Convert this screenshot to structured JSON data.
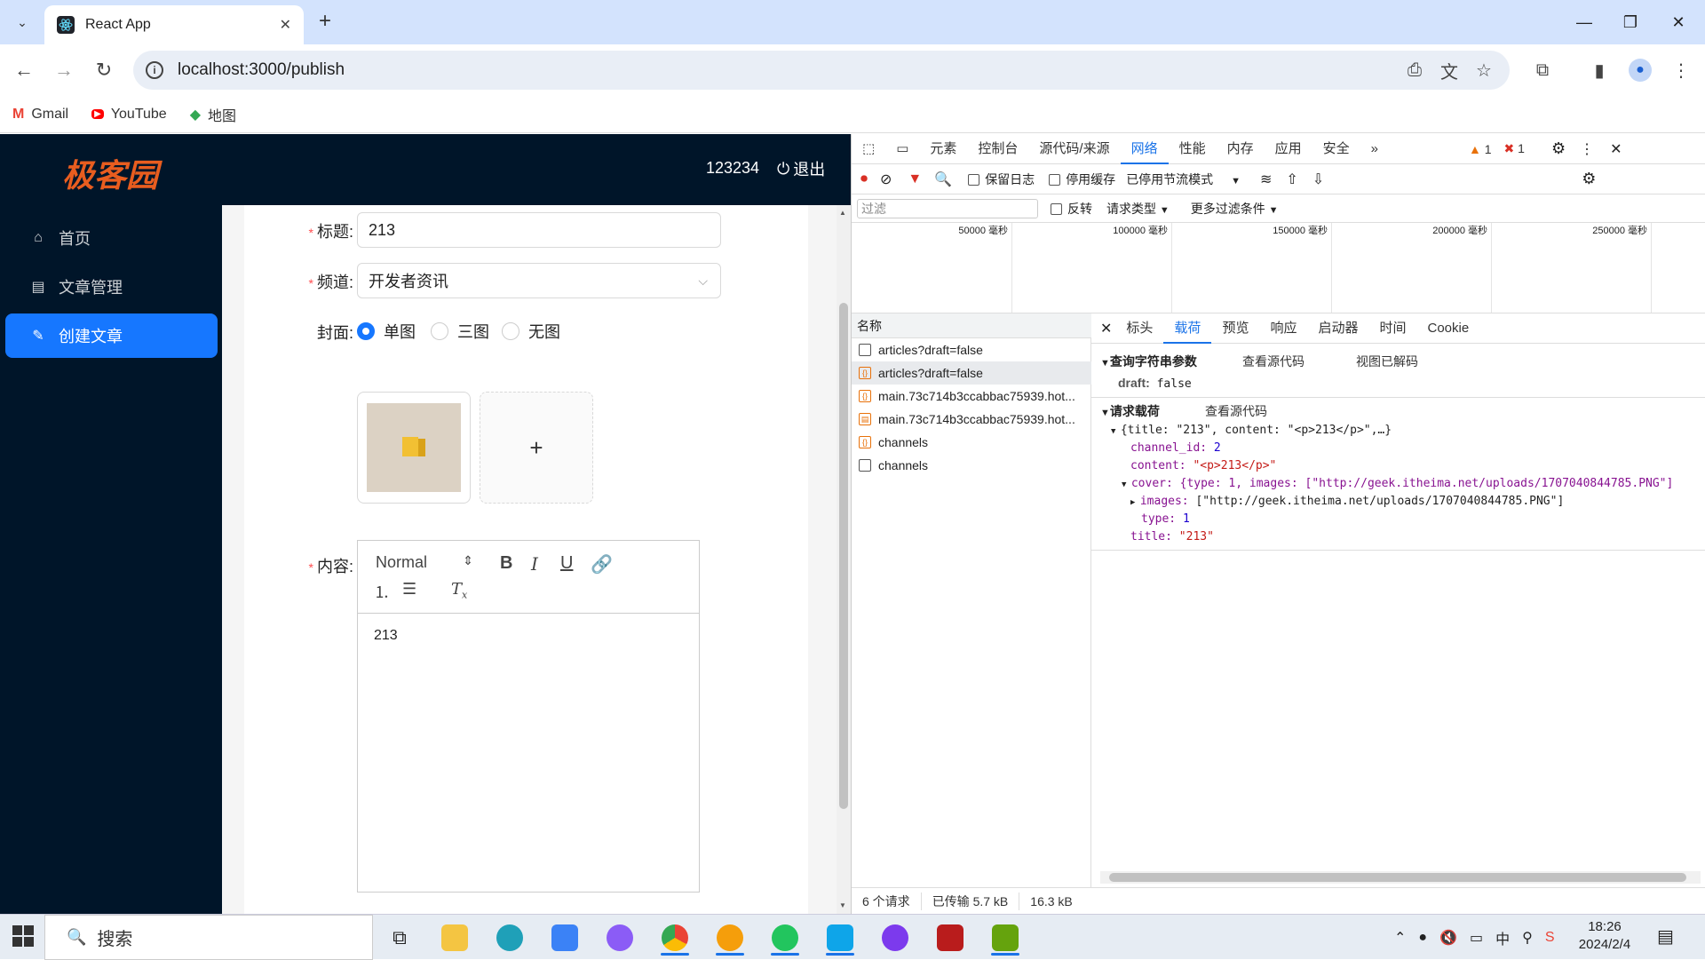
{
  "browser": {
    "tab_title": "React App",
    "url": "localhost:3000/publish",
    "bookmarks": [
      {
        "label": "Gmail",
        "icon": "gmail-icon"
      },
      {
        "label": "YouTube",
        "icon": "youtube-icon"
      },
      {
        "label": "地图",
        "icon": "maps-icon"
      }
    ]
  },
  "app": {
    "logo": "极客园",
    "username": "123234",
    "logout": "退出",
    "menu": [
      {
        "label": "首页",
        "icon": "home-icon"
      },
      {
        "label": "文章管理",
        "icon": "article-icon"
      },
      {
        "label": "创建文章",
        "icon": "edit-icon",
        "active": true
      }
    ],
    "form": {
      "title_label": "标题:",
      "title_value": "213",
      "channel_label": "频道:",
      "channel_value": "开发者资讯",
      "cover_label": "封面:",
      "cover_options": [
        "单图",
        "三图",
        "无图"
      ],
      "cover_selected": "单图",
      "upload_plus": "+",
      "content_label": "内容:",
      "editor_format": "Normal",
      "editor_text": "213"
    }
  },
  "devtools": {
    "tabs": [
      "元素",
      "控制台",
      "源代码/来源",
      "网络",
      "性能",
      "内存",
      "应用",
      "安全"
    ],
    "active_tab": "网络",
    "warnings": "1",
    "errors": "1",
    "toolbar": {
      "preserve_log": "保留日志",
      "disable_cache": "停用缓存",
      "throttling": "已停用节流模式"
    },
    "filter": {
      "placeholder": "过滤",
      "invert": "反转",
      "request_types": "请求类型",
      "more_filters": "更多过滤条件"
    },
    "timeline_ticks": [
      "50000 毫秒",
      "100000 毫秒",
      "150000 毫秒",
      "200000 毫秒",
      "250000 毫秒"
    ],
    "list_header": "名称",
    "requests": [
      {
        "name": "articles?draft=false",
        "icon": "checkbox-icon"
      },
      {
        "name": "articles?draft=false",
        "icon": "xhr-icon",
        "selected": true
      },
      {
        "name": "main.73c714b3ccabbac75939.hot...",
        "icon": "xhr-icon"
      },
      {
        "name": "main.73c714b3ccabbac75939.hot...",
        "icon": "script-icon"
      },
      {
        "name": "channels",
        "icon": "xhr-icon"
      },
      {
        "name": "channels",
        "icon": "checkbox-icon"
      }
    ],
    "detail_tabs": [
      "标头",
      "载荷",
      "预览",
      "响应",
      "启动器",
      "时间",
      "Cookie"
    ],
    "detail_active": "载荷",
    "payload": {
      "query_title": "查询字符串参数",
      "view_source": "查看源代码",
      "view_decoded": "视图已解码",
      "query_key": "draft:",
      "query_value": "false",
      "body_title": "请求载荷",
      "body_view_source": "查看源代码",
      "summary": "{title: \"213\", content: \"<p>213</p>\",…}",
      "channel_key": "channel_id:",
      "channel_val": "2",
      "content_key": "content:",
      "content_val": "\"<p>213</p>\"",
      "cover_summary": "cover: {type: 1, images: [\"http://geek.itheima.net/uploads/1707040844785.PNG\"]",
      "images_key": "images:",
      "images_val": "[\"http://geek.itheima.net/uploads/1707040844785.PNG\"]",
      "type_key": "type:",
      "type_val": "1",
      "title_key": "title:",
      "title_val": "\"213\""
    },
    "status": {
      "requests": "6 个请求",
      "transferred": "已传输 5.7 kB",
      "resources": "16.3 kB"
    }
  },
  "taskbar": {
    "search": "搜索",
    "time": "18:26",
    "date": "2024/2/4",
    "ime": "中"
  }
}
